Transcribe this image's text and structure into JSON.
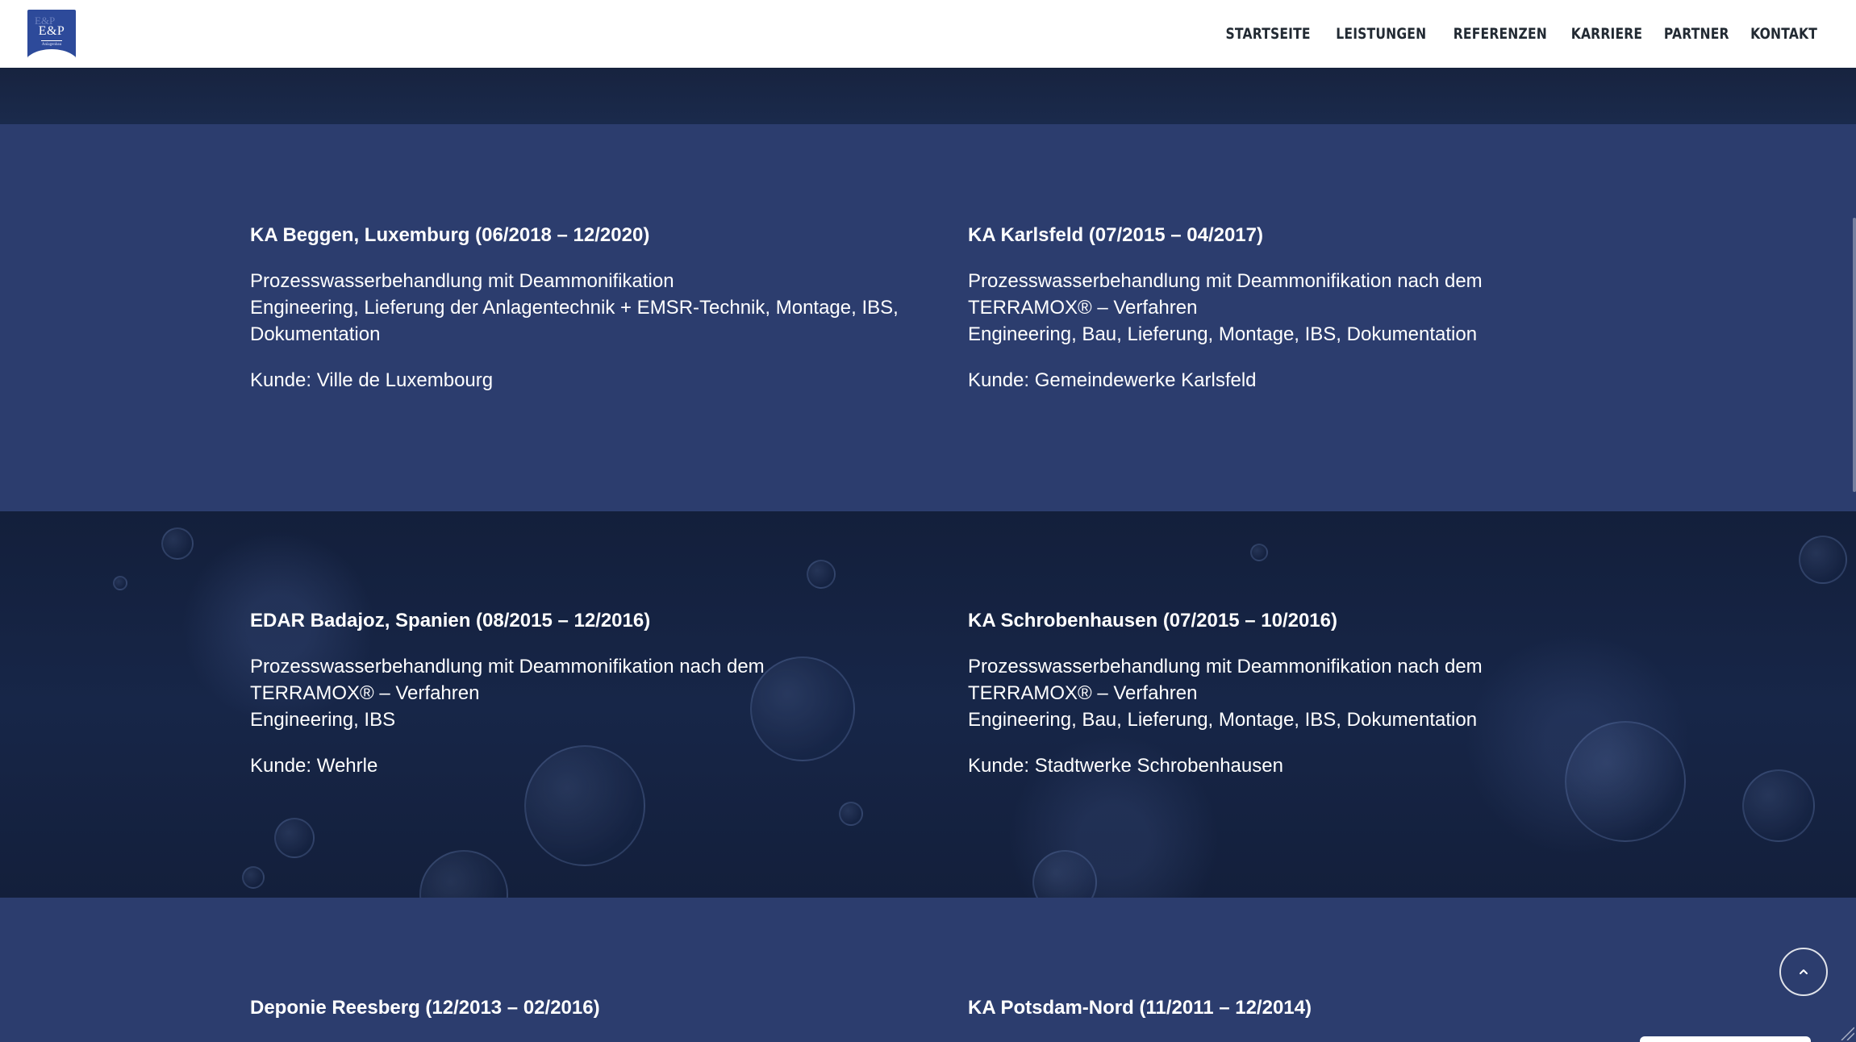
{
  "logo": {
    "text": "E&P",
    "ghost": "E&P",
    "sub": "Anlagenbau"
  },
  "nav": {
    "items": [
      {
        "label": "Startseite"
      },
      {
        "label": "Leistungen"
      },
      {
        "label": "Referenzen"
      },
      {
        "label": "Karriere"
      },
      {
        "label": "Partner"
      },
      {
        "label": "Kontakt"
      }
    ]
  },
  "references": [
    {
      "title": "KA Beggen, Luxemburg (06/2018 – 12/2020)",
      "lines": [
        "Prozesswasserbehandlung mit Deammonifikation",
        "Engineering, Lieferung der Anlagentechnik + EMSR-Technik, Montage, IBS, Dokumentation"
      ],
      "client": "Kunde: Ville de Luxembourg"
    },
    {
      "title": "KA Karlsfeld (07/2015 – 04/2017)",
      "lines": [
        "Prozesswasserbehandlung mit Deammonifikation nach dem TERRAMOX® – Verfahren",
        "Engineering, Bau, Lieferung, Montage, IBS, Dokumentation"
      ],
      "client": "Kunde: Gemeindewerke Karlsfeld"
    },
    {
      "title": "EDAR Badajoz, Spanien (08/2015 – 12/2016)",
      "lines": [
        "Prozesswasserbehandlung mit Deammonifikation nach dem TERRAMOX® – Verfahren",
        "Engineering, IBS"
      ],
      "client": "Kunde: Wehrle"
    },
    {
      "title": "KA Schrobenhausen (07/2015 – 10/2016)",
      "lines": [
        "Prozesswasserbehandlung mit Deammonifikation nach dem TERRAMOX® – Verfahren",
        "Engineering, Bau, Lieferung, Montage, IBS, Dokumentation"
      ],
      "client": "Kunde: Stadtwerke Schrobenhausen"
    },
    {
      "title": "Deponie Reesberg (12/2013 – 02/2016)"
    },
    {
      "title": "KA Potsdam-Nord (11/2011 – 12/2014)"
    }
  ],
  "icons": {
    "scroll_top": "chevron-up-icon"
  },
  "colors": {
    "section_light": "#2c3d6e",
    "section_dark": "#131f3b",
    "logo_blue": "#2d4a9a",
    "nav_text": "#222a33"
  }
}
